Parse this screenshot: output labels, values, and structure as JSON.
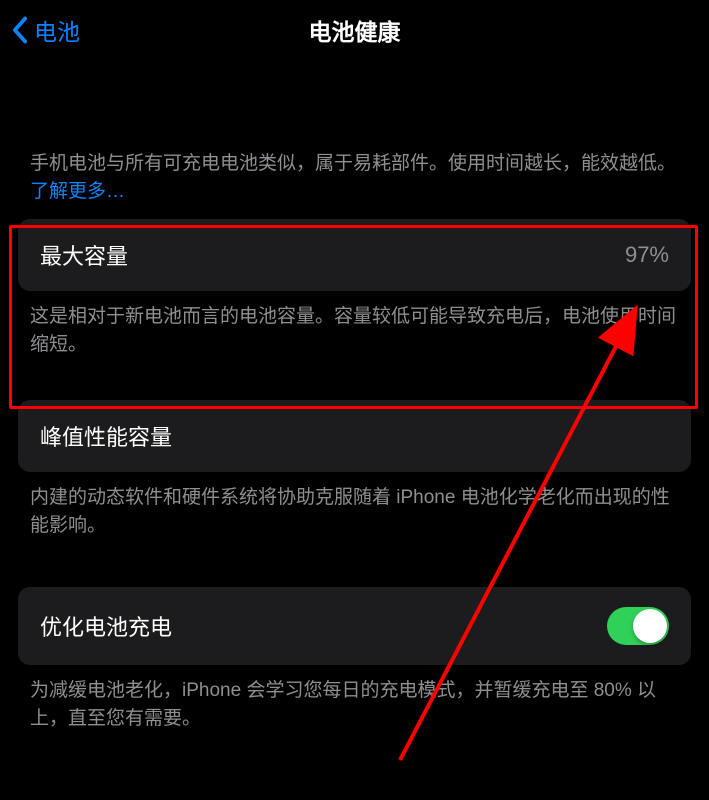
{
  "nav": {
    "back_label": "电池",
    "title": "电池健康"
  },
  "intro": {
    "text": "手机电池与所有可充电电池类似，属于易耗部件。使用时间越长，能效越低。",
    "link": "了解更多…"
  },
  "max_capacity": {
    "label": "最大容量",
    "value": "97%",
    "footer": "这是相对于新电池而言的电池容量。容量较低可能导致充电后，电池使用时间缩短。"
  },
  "peak_performance": {
    "label": "峰值性能容量",
    "footer": "内建的动态软件和硬件系统将协助克服随着 iPhone 电池化学老化而出现的性能影响。"
  },
  "optimized_charging": {
    "label": "优化电池充电",
    "enabled": true,
    "footer": "为减缓电池老化，iPhone 会学习您每日的充电模式，并暂缓充电至 80% 以上，直至您有需要。"
  },
  "annotation": {
    "highlight_color": "#ff0000"
  }
}
